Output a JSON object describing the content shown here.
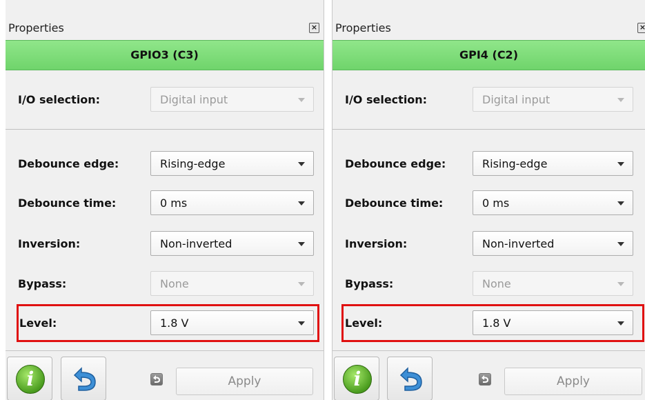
{
  "panels": [
    {
      "title": "Properties",
      "header": "GPIO3 (C3)",
      "io_selection": {
        "label": "I/O selection:",
        "value": "Digital input"
      },
      "debounce_edge": {
        "label": "Debounce edge:",
        "value": "Rising-edge"
      },
      "debounce_time": {
        "label": "Debounce time:",
        "value": "0 ms"
      },
      "inversion": {
        "label": "Inversion:",
        "value": "Non-inverted"
      },
      "bypass": {
        "label": "Bypass:",
        "value": "None"
      },
      "level": {
        "label": "Level:",
        "value": "1.8 V"
      },
      "apply_label": "Apply"
    },
    {
      "title": "Properties",
      "header": "GPI4 (C2)",
      "io_selection": {
        "label": "I/O selection:",
        "value": "Digital input"
      },
      "debounce_edge": {
        "label": "Debounce edge:",
        "value": "Rising-edge"
      },
      "debounce_time": {
        "label": "Debounce time:",
        "value": "0 ms"
      },
      "inversion": {
        "label": "Inversion:",
        "value": "Non-inverted"
      },
      "bypass": {
        "label": "Bypass:",
        "value": "None"
      },
      "level": {
        "label": "Level:",
        "value": "1.8 V"
      },
      "apply_label": "Apply"
    }
  ],
  "colors": {
    "header_green": "#7cdc76",
    "highlight_red": "#e01010"
  },
  "icons": {
    "close": "close-icon",
    "info": "info-icon",
    "undo": "undo-icon"
  }
}
